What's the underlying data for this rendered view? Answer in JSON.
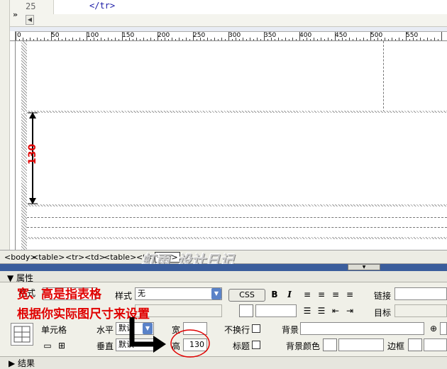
{
  "code": {
    "line_number": "25",
    "line_text": "</tr>",
    "collapse_icon": "»"
  },
  "ruler": {
    "ticks": [
      "0",
      "50",
      "100",
      "150",
      "200",
      "250",
      "300",
      "350",
      "400",
      "450",
      "500",
      "550"
    ]
  },
  "measurement": {
    "label": "130"
  },
  "tag_selector": {
    "tags": [
      "<body>",
      "<table>",
      "<tr>",
      "<td>",
      "<table>",
      "<tr>",
      "<td>"
    ]
  },
  "watermark": "虹雨_设计日记",
  "properties": {
    "title": "▼ 属性",
    "format_label": "格式",
    "style_label": "样式",
    "style_value": "无",
    "css_button": "CSS",
    "bold": "B",
    "italic": "I",
    "link_label": "链接",
    "target_label": "目标",
    "cell_label": "单元格",
    "horizontal_label": "水平",
    "horizontal_value": "默认",
    "vertical_label": "垂直",
    "vertical_value": "默认",
    "width_label": "宽",
    "width_value": "",
    "height_label": "高",
    "height_value": "130",
    "nowrap_label": "不换行",
    "header_label": "标题",
    "bg_label": "背景",
    "bgcolor_label": "背景颜色",
    "border_label": "边框",
    "results_label": "▶ 结果"
  },
  "annotations": {
    "line1": "宽、高是指表格",
    "line2": "根据你实际图尺寸来设置"
  },
  "colors": {
    "annotation_red": "#e00000",
    "panel_blue": "#3a5d9c"
  }
}
